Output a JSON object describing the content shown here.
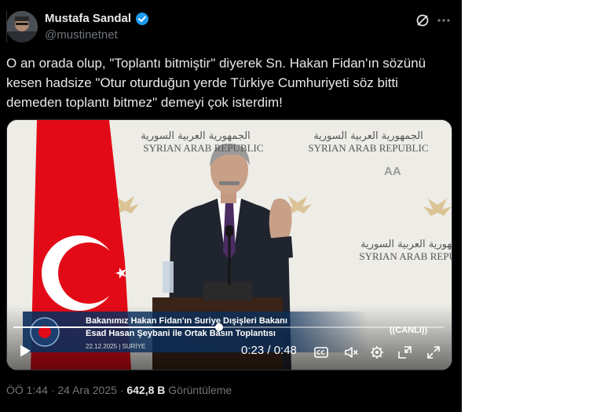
{
  "author": {
    "name": "Mustafa Sandal",
    "handle": "@mustinetnet",
    "verified": true
  },
  "tweet": {
    "text": "O an orada olup, \"Toplantı bitmiştir\" diyerek Sn. Hakan Fidan'ın sözünü\nkesen hadsize \"Otur oturduğun yerde Türkiye Cumhuriyeti söz bitti\ndemeden toplantı bitmez\" demeyi çok isterdim!"
  },
  "video": {
    "backdrop_text_ar": "الجمهورية العربية السورية",
    "backdrop_text_en": "SYRIAN ARAB REPUBLIC",
    "lower_third_line1": "Bakanımız Hakan Fidan'ın Suriye Dışişleri Bakanı",
    "lower_third_line2": "Esad Hasan Şeybani ile Ortak Basın Toplantısı",
    "lower_third_meta": "22.12.2025 | SURİYE",
    "live_label": "((CANLI))",
    "aa_logo": "AA",
    "time_current": "0:23",
    "time_total": "0:48",
    "time_display": "0:23 / 0:48",
    "progress_fraction": 0.479
  },
  "footer": {
    "time": "ÖÖ 1:44",
    "separator": "·",
    "date": "24 Ara 2025",
    "views_count": "642,8 B",
    "views_label": "Görüntüleme"
  },
  "colors": {
    "background": "#000000",
    "text_primary": "#e7e9ea",
    "text_secondary": "#71767b",
    "verified_blue": "#1d9bf0",
    "flag_red": "#e30a17"
  },
  "icons": [
    "verified-badge-icon",
    "grok-icon",
    "more-icon",
    "play-icon",
    "cc-icon",
    "settings-icon",
    "pip-icon",
    "fullscreen-icon"
  ]
}
